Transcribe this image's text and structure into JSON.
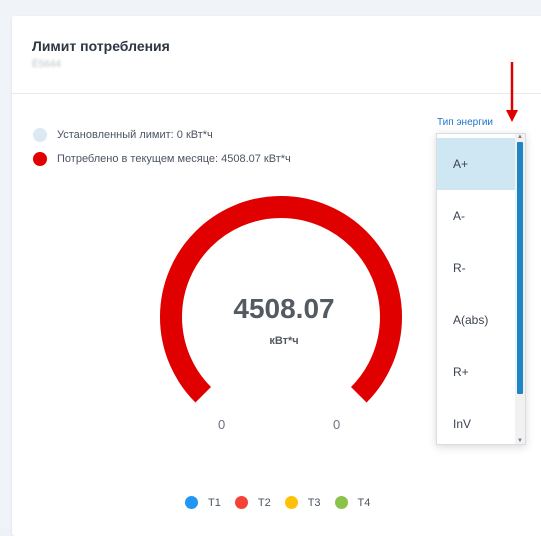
{
  "card": {
    "title": "Лимит потребления",
    "subtitle": "Ё5644"
  },
  "legend_top": [
    {
      "label": "Установленный лимит: 0 кВт*ч",
      "color": "#dce8f3"
    },
    {
      "label": "Потреблено в текущем месяце: 4508.07 кВт*ч",
      "color": "#e00000"
    }
  ],
  "gauge": {
    "value": "4508.07",
    "unit": "кВт*ч",
    "min_label": "0",
    "max_label": "0",
    "fill_fraction": 1.0,
    "arc_color": "#e00000",
    "track_color": "#d9d9d9"
  },
  "legend_bottom": [
    {
      "label": "T1",
      "color": "#2196f3"
    },
    {
      "label": "T2",
      "color": "#f44336"
    },
    {
      "label": "T3",
      "color": "#ffc107"
    },
    {
      "label": "T4",
      "color": "#8bc34a"
    }
  ],
  "energy_type": {
    "label": "Тип энергии",
    "options": [
      "A+",
      "A-",
      "R-",
      "A(abs)",
      "R+",
      "InV"
    ],
    "selected": "A+"
  },
  "annotation": {
    "arrow_color": "#e00000"
  }
}
